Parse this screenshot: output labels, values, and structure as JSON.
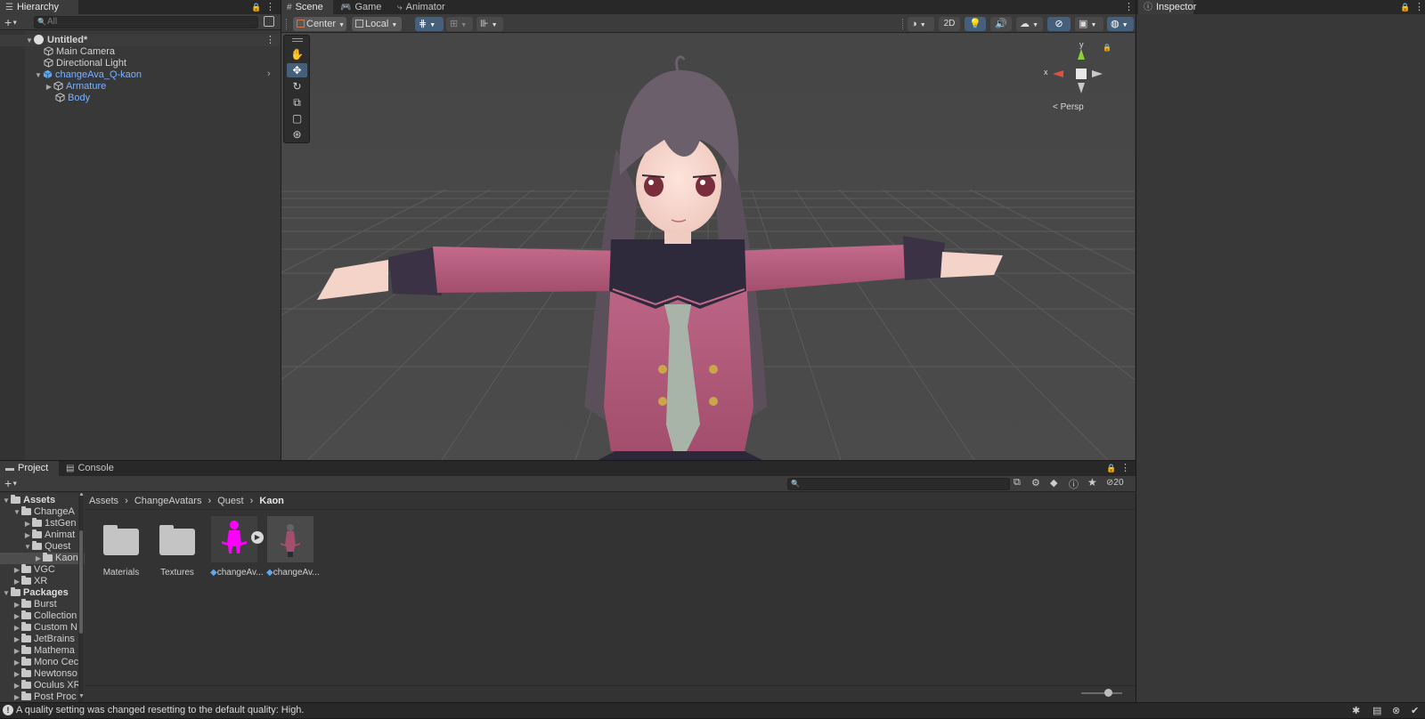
{
  "hierarchy": {
    "tab_label": "Hierarchy",
    "search_placeholder": "All",
    "items": [
      {
        "label": "Untitled*"
      },
      {
        "label": "Main Camera"
      },
      {
        "label": "Directional Light"
      },
      {
        "label": "changeAva_Q-kaon"
      },
      {
        "label": "Armature"
      },
      {
        "label": "Body"
      }
    ]
  },
  "scene_view": {
    "tabs": [
      {
        "label": "Scene",
        "icon": "grid-icon"
      },
      {
        "label": "Game",
        "icon": "gamepad-icon"
      },
      {
        "label": "Animator",
        "icon": "animator-icon"
      }
    ],
    "pivot_mode": "Center",
    "pivot_rotation": "Local",
    "mode_2d_label": "2D",
    "gizmo": {
      "x_label": "x",
      "y_label": "y",
      "projection_label": "Persp"
    },
    "tools": [
      "hand-tool",
      "move-tool",
      "rotate-tool",
      "scale-tool",
      "rect-tool",
      "transform-tool"
    ],
    "selected_tool": "move-tool"
  },
  "inspector": {
    "tab_label": "Inspector"
  },
  "project": {
    "tabs": [
      {
        "label": "Project"
      },
      {
        "label": "Console"
      }
    ],
    "hidden_count": "20",
    "breadcrumb": [
      "Assets",
      "ChangeAvatars",
      "Quest",
      "Kaon"
    ],
    "tree": [
      {
        "label": "Assets"
      },
      {
        "label": "ChangeA"
      },
      {
        "label": "1stGen"
      },
      {
        "label": "Animat"
      },
      {
        "label": "Quest"
      },
      {
        "label": "Kaon"
      },
      {
        "label": "VGC"
      },
      {
        "label": "XR"
      },
      {
        "label": "Packages"
      },
      {
        "label": "Burst"
      },
      {
        "label": "Collection"
      },
      {
        "label": "Custom N"
      },
      {
        "label": "JetBrains"
      },
      {
        "label": "Mathema"
      },
      {
        "label": "Mono Cec"
      },
      {
        "label": "Newtonso"
      },
      {
        "label": "Oculus XR"
      },
      {
        "label": "Post Proc"
      }
    ],
    "assets": [
      {
        "label": "Materials",
        "kind": "folder"
      },
      {
        "label": "Textures",
        "kind": "folder"
      },
      {
        "label": "changeAv...",
        "kind": "prefab"
      },
      {
        "label": "changeAv...",
        "kind": "model"
      }
    ]
  },
  "status": {
    "message": "A quality setting was changed resetting to the default quality: High."
  },
  "colors": {
    "accent": "#46607c",
    "selection_text": "#7cb2ff",
    "panel": "#383838",
    "tabbar": "#282828"
  }
}
